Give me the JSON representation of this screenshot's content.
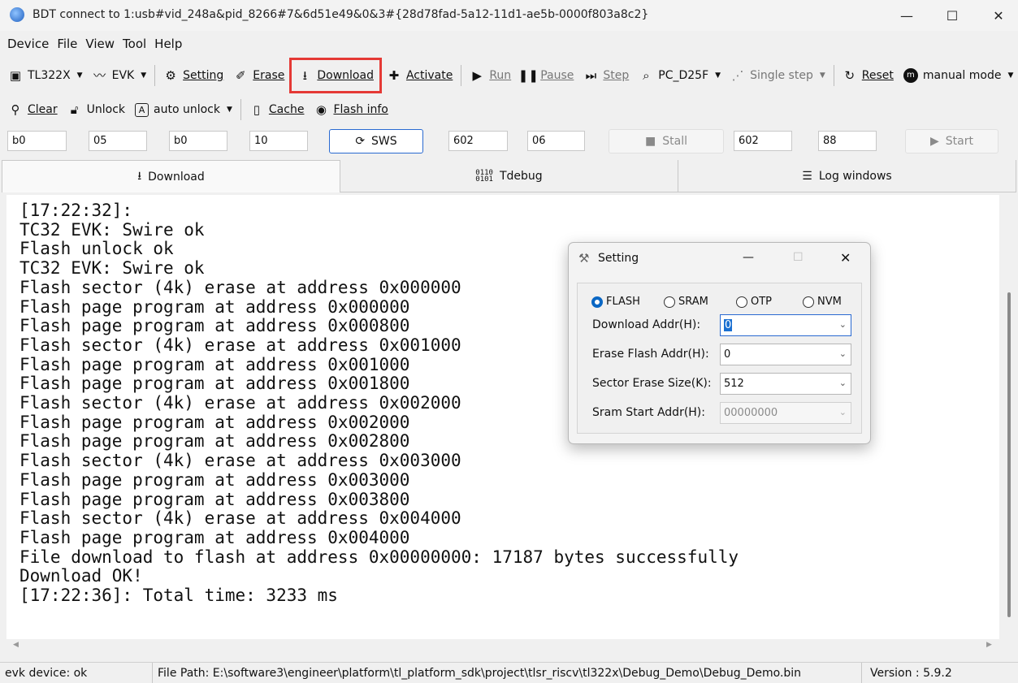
{
  "window": {
    "title": "BDT connect to 1:usb#vid_248a&pid_8266#7&6d51e49&0&3#{28d78fad-5a12-11d1-ae5b-0000f803a8c2}",
    "minimize": "—",
    "maximize": "☐",
    "close": "✕"
  },
  "menu": [
    "Device",
    "File",
    "View",
    "Tool",
    "Help"
  ],
  "toolbar1": {
    "chip": "TL322X",
    "board": "EVK",
    "setting": "Setting",
    "erase": "Erase",
    "download": "Download",
    "activate": "Activate",
    "run": "Run",
    "pause": "Pause",
    "step": "Step",
    "pc": "PC_D25F",
    "single_step": "Single step",
    "reset": "Reset",
    "mode": "manual mode"
  },
  "toolbar2": {
    "clear": "Clear",
    "unlock": "Unlock",
    "auto_unlock": "auto unlock",
    "cache": "Cache",
    "flash_info": "Flash info"
  },
  "params": {
    "f1": "b0",
    "f2": "05",
    "f3": "b0",
    "f4": "10",
    "sws": "SWS",
    "f5": "602",
    "f6": "06",
    "stall": "Stall",
    "f7": "602",
    "f8": "88",
    "start": "Start"
  },
  "tabs": [
    "Download",
    "Tdebug",
    "Log windows"
  ],
  "log": [
    "[17:22:32]:",
    "TC32 EVK: Swire ok",
    "Flash unlock ok",
    "TC32 EVK: Swire ok",
    "Flash sector (4k) erase at address 0x000000",
    "Flash page program at address 0x000000",
    "Flash page program at address 0x000800",
    "Flash sector (4k) erase at address 0x001000",
    "Flash page program at address 0x001000",
    "Flash page program at address 0x001800",
    "Flash sector (4k) erase at address 0x002000",
    "Flash page program at address 0x002000",
    "Flash page program at address 0x002800",
    "Flash sector (4k) erase at address 0x003000",
    "Flash page program at address 0x003000",
    "Flash page program at address 0x003800",
    "Flash sector (4k) erase at address 0x004000",
    "Flash page program at address 0x004000",
    "File download to flash at address 0x00000000: 17187 bytes successfully",
    "Download OK!",
    "[17:22:36]: Total time: 3233 ms"
  ],
  "status": {
    "device": "evk device: ok",
    "file_path": "File Path:  E:\\software3\\engineer\\platform\\tl_platform_sdk\\project\\tlsr_riscv\\tl322x\\Debug_Demo\\Debug_Demo.bin",
    "version": "Version : 5.9.2"
  },
  "dialog": {
    "title": "Setting",
    "minimize": "—",
    "maximize": "☐",
    "close": "✕",
    "radios": [
      {
        "label": "FLASH",
        "checked": true
      },
      {
        "label": "SRAM",
        "checked": false
      },
      {
        "label": "OTP",
        "checked": false
      },
      {
        "label": "NVM",
        "checked": false
      }
    ],
    "download_addr_label": "Download  Addr(H):",
    "download_addr_value": "0",
    "erase_addr_label": "Erase Flash Addr(H):",
    "erase_addr_value": "0",
    "sector_size_label": "Sector Erase Size(K):",
    "sector_size_value": "512",
    "sram_start_label": "Sram Start Addr(H):",
    "sram_start_value": "00000000"
  },
  "colors": {
    "accent": "#2a6ad1",
    "highlight_box": "#e53935",
    "radio_on": "#0a67c4"
  }
}
